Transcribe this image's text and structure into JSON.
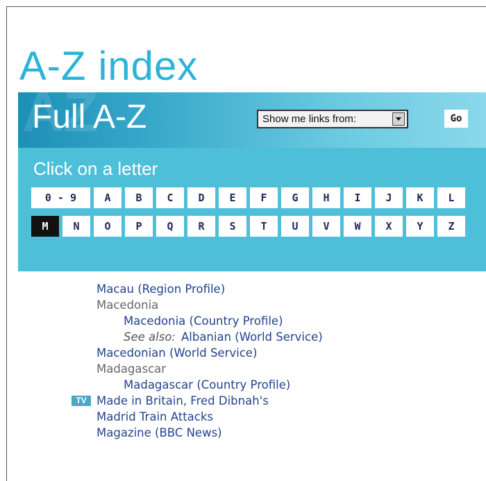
{
  "page": {
    "title": "A-Z index"
  },
  "panel": {
    "heading": "Full A-Z",
    "background_letters": "AZ",
    "links_select": {
      "selected": "Show me links from:"
    },
    "go_label": "Go",
    "click_prompt": "Click on a letter",
    "letters_row1": [
      "0 - 9",
      "A",
      "B",
      "C",
      "D",
      "E",
      "F",
      "G",
      "H",
      "I",
      "J",
      "K",
      "L"
    ],
    "letters_row2": [
      "M",
      "N",
      "O",
      "P",
      "Q",
      "R",
      "S",
      "T",
      "U",
      "V",
      "W",
      "X",
      "Y",
      "Z"
    ],
    "active_letter": "M"
  },
  "entries": [
    {
      "text": "Macau (Region Profile)",
      "kind": "link",
      "indent": 0
    },
    {
      "text": "Macedonia",
      "kind": "heading",
      "indent": 0
    },
    {
      "text": "Macedonia (Country Profile)",
      "kind": "link",
      "indent": 1
    },
    {
      "prefix": "See also:",
      "text": "Albanian (World Service)",
      "kind": "link",
      "indent": 1
    },
    {
      "text": "Macedonian (World Service)",
      "kind": "link",
      "indent": 0
    },
    {
      "text": "Madagascar",
      "kind": "heading",
      "indent": 0
    },
    {
      "text": "Madagascar (Country Profile)",
      "kind": "link",
      "indent": 1
    },
    {
      "text": "Made in Britain, Fred Dibnah's",
      "kind": "link",
      "indent": 0,
      "badge": "TV"
    },
    {
      "text": "Madrid Train Attacks",
      "kind": "link",
      "indent": 0
    },
    {
      "text": "Magazine (BBC News)",
      "kind": "link",
      "indent": 0
    }
  ],
  "colors": {
    "title": "#29b4d8",
    "panel": "#4ebfd9",
    "link": "#22438f",
    "active_letter_bg": "#111111"
  }
}
